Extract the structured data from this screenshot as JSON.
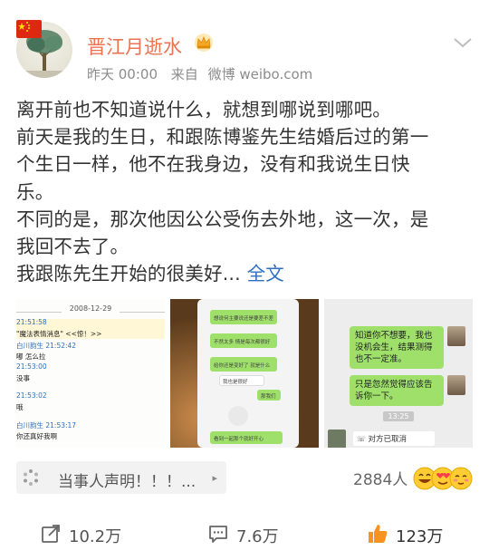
{
  "post": {
    "username": "晋江月逝水",
    "time": "昨天 00:00",
    "source_prefix": "来自",
    "source": "微博 weibo.com",
    "lines": [
      "离开前也不知道说什么，就想到哪说到哪吧。",
      "前天是我的生日，和跟陈博鉴先生结婚后过的第一",
      "个生日一样，他不在我身边，没有和我说生日快",
      "乐。",
      "不同的是，那次他因公公受伤去外地，这一次，是",
      "我回不去了。"
    ],
    "last_line": "我跟陈先生开始的很美好...",
    "fulltext_link": "全文"
  },
  "images": {
    "thumb1": {
      "date": "2008-12-29",
      "lines": [
        {
          "text": "21:51:58",
          "style": "blue"
        },
        {
          "text": "\"魔法表情消息\" <<惊！>>",
          "style": "dark"
        },
        {
          "text": "白川韵生  21:52:42",
          "style": "blue"
        },
        {
          "text": "嘟 怎么拉",
          "style": "dark"
        },
        {
          "text": "21:53:00",
          "style": "blue"
        },
        {
          "text": "没事",
          "style": "dark"
        },
        {
          "text": "21:53:02",
          "style": "blue"
        },
        {
          "text": "哦",
          "style": "dark"
        },
        {
          "text": "白川韵生  21:53:17",
          "style": "blue"
        },
        {
          "text": "你还真好我啊",
          "style": "dark"
        }
      ]
    },
    "thumb2": {
      "lines": [
        "想说何主要说还是要差不差",
        "不然太多 情是每次都很好",
        "给你还是变好了 就是什么",
        "我也是很好",
        "那我们",
        "看到一起那个就好开心"
      ]
    },
    "thumb3": {
      "bubble1": "知道你不想要，我也没机会生，结果测得也不一定准。",
      "bubble2": "只是忽然觉得应该告诉你一下。",
      "time": "13:25",
      "cancel": "对方已取消"
    }
  },
  "topic": {
    "label": "当事人声明！！！...",
    "arrow": "▸"
  },
  "reactions": {
    "people": "2884人"
  },
  "actions": {
    "repost": "10.2万",
    "comment": "7.6万",
    "like": "123万"
  },
  "colors": {
    "username": "#eb7350",
    "link": "#2f6fc1",
    "like_icon": "#f7931e"
  }
}
